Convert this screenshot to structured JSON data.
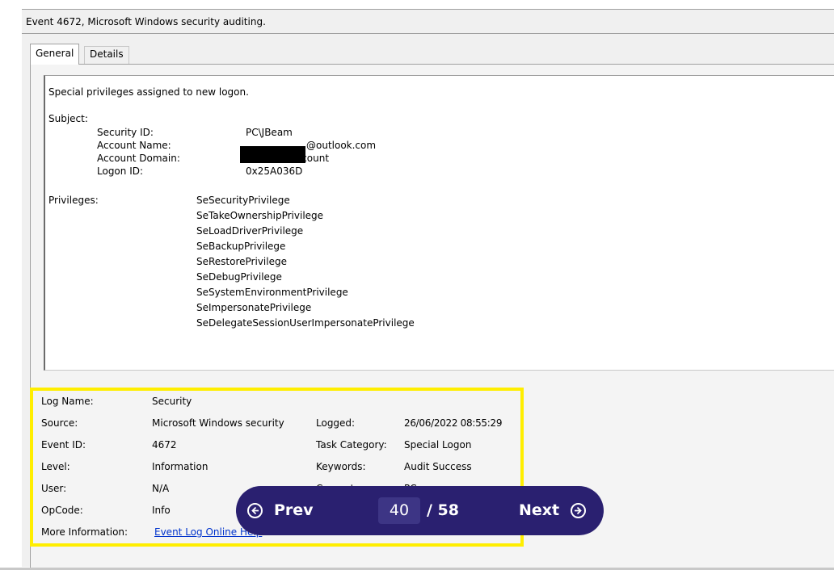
{
  "window": {
    "title": "Event 4672, Microsoft Windows security auditing."
  },
  "tabs": [
    {
      "label": "General"
    },
    {
      "label": "Details"
    }
  ],
  "description": {
    "summary": "Special privileges assigned to new logon.",
    "subject_heading": "Subject:",
    "subject": {
      "security_id_label": "Security ID:",
      "security_id": "PC\\JBeam",
      "account_name_label": "Account Name:",
      "account_name_suffix": "@outlook.com",
      "account_domain_label": "Account Domain:",
      "account_domain": "MicrosoftAccount",
      "logon_id_label": "Logon ID:",
      "logon_id": "0x25A036D"
    },
    "privileges_label": "Privileges:",
    "privileges": [
      "SeSecurityPrivilege",
      "SeTakeOwnershipPrivilege",
      "SeLoadDriverPrivilege",
      "SeBackupPrivilege",
      "SeRestorePrivilege",
      "SeDebugPrivilege",
      "SeSystemEnvironmentPrivilege",
      "SeImpersonatePrivilege",
      "SeDelegateSessionUserImpersonatePrivilege"
    ]
  },
  "details": {
    "log_name_label": "Log Name:",
    "log_name": "Security",
    "source_label": "Source:",
    "source": "Microsoft Windows security",
    "logged_label": "Logged:",
    "logged": "26/06/2022 08:55:29",
    "event_id_label": "Event ID:",
    "event_id": "4672",
    "task_category_label": "Task Category:",
    "task_category": "Special Logon",
    "level_label": "Level:",
    "level": "Information",
    "keywords_label": "Keywords:",
    "keywords": "Audit Success",
    "user_label": "User:",
    "user": "N/A",
    "computer_label": "Computer:",
    "computer": "PC",
    "opcode_label": "OpCode:",
    "opcode": "Info",
    "more_info_label": "More Information:",
    "more_info_link": "Event Log Online Help"
  },
  "pager": {
    "prev_label": "Prev",
    "next_label": "Next",
    "current_page": "40",
    "total": "/ 58"
  },
  "colors": {
    "highlight": "#ffee00",
    "pager_bg": "#2a2070",
    "link": "#0033cc"
  }
}
